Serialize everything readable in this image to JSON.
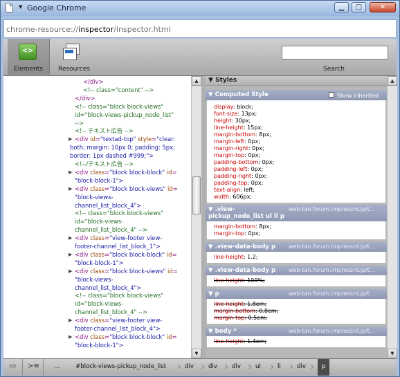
{
  "window": {
    "title": "Google Chrome",
    "controls": [
      "minimize",
      "maximize",
      "close"
    ]
  },
  "address": {
    "prefix": "chrome-resource://",
    "host": "inspector",
    "path": "/inspector.html"
  },
  "toolbar": {
    "elements_label": "Elements",
    "resources_label": "Resources",
    "search_label": "Search",
    "search_value": ""
  },
  "dom_tree": [
    [
      {
        "t": "tag",
        "v": "</div>"
      }
    ],
    [
      {
        "t": "cmt",
        "v": "<!-- class=\"content\" -->"
      }
    ],
    [
      {
        "t": "tag",
        "v": "</div>"
      }
    ],
    [
      {
        "t": "cmt",
        "v": "<!-- class=\"block block-views\""
      }
    ],
    [
      {
        "t": "cmt",
        "v": "id=\"block-views-pickup_node_list\""
      }
    ],
    [
      {
        "t": "cmt",
        "v": "-->"
      }
    ],
    [
      {
        "t": "cmt",
        "v": "<!-- テキスト広告 -->"
      }
    ],
    [
      {
        "t": "tag",
        "v": "<div "
      },
      {
        "t": "attr",
        "v": "id"
      },
      {
        "t": "tag",
        "v": "="
      },
      {
        "t": "val",
        "v": "\"textad-top\""
      },
      {
        "t": "attr",
        "v": " style"
      },
      {
        "t": "tag",
        "v": "="
      },
      {
        "t": "val",
        "v": "\"clear:"
      }
    ],
    [
      {
        "t": "val",
        "v": "both; margin: 10px 0; padding: 5px;"
      }
    ],
    [
      {
        "t": "val",
        "v": "border: 1px dashed #999;\">"
      }
    ],
    [
      {
        "t": "cmt",
        "v": "<!--/テキスト広告 -->"
      }
    ],
    [
      {
        "t": "tag",
        "v": "<div "
      },
      {
        "t": "attr",
        "v": "class"
      },
      {
        "t": "tag",
        "v": "="
      },
      {
        "t": "val",
        "v": "\"block block-block\""
      },
      {
        "t": "attr",
        "v": " id"
      },
      {
        "t": "tag",
        "v": "="
      }
    ],
    [
      {
        "t": "val",
        "v": "\"block-block-1\">"
      }
    ],
    [
      {
        "t": "tag",
        "v": "<div "
      },
      {
        "t": "attr",
        "v": "class"
      },
      {
        "t": "tag",
        "v": "="
      },
      {
        "t": "val",
        "v": "\"block block-views\""
      },
      {
        "t": "attr",
        "v": " id"
      },
      {
        "t": "tag",
        "v": "="
      }
    ],
    [
      {
        "t": "val",
        "v": "\"block-views-"
      }
    ],
    [
      {
        "t": "val",
        "v": "channel_list_block_4\">"
      }
    ],
    [
      {
        "t": "cmt",
        "v": "<!-- class=\"block block-views\""
      }
    ],
    [
      {
        "t": "cmt",
        "v": "id=\"block-views-"
      }
    ],
    [
      {
        "t": "cmt",
        "v": "channel_list_block_4\" -->"
      }
    ],
    [
      {
        "t": "tag",
        "v": "<div "
      },
      {
        "t": "attr",
        "v": "class"
      },
      {
        "t": "tag",
        "v": "="
      },
      {
        "t": "val",
        "v": "\"view-footer view-"
      }
    ],
    [
      {
        "t": "val",
        "v": "footer-channel_list_block_1\">"
      }
    ],
    [
      {
        "t": "tag",
        "v": "<div "
      },
      {
        "t": "attr",
        "v": "class"
      },
      {
        "t": "tag",
        "v": "="
      },
      {
        "t": "val",
        "v": "\"block block-block\""
      },
      {
        "t": "attr",
        "v": " id"
      },
      {
        "t": "tag",
        "v": "="
      }
    ],
    [
      {
        "t": "val",
        "v": "\"block-block-1\">"
      }
    ],
    [
      {
        "t": "tag",
        "v": "<div "
      },
      {
        "t": "attr",
        "v": "class"
      },
      {
        "t": "tag",
        "v": "="
      },
      {
        "t": "val",
        "v": "\"block block-views\""
      },
      {
        "t": "attr",
        "v": " id"
      },
      {
        "t": "tag",
        "v": "="
      }
    ],
    [
      {
        "t": "val",
        "v": "\"block-views-"
      }
    ],
    [
      {
        "t": "val",
        "v": "channel_list_block_4\">"
      }
    ],
    [
      {
        "t": "cmt",
        "v": "<!-- class=\"block block-views\""
      }
    ],
    [
      {
        "t": "cmt",
        "v": "id=\"block-views-"
      }
    ],
    [
      {
        "t": "cmt",
        "v": "channel_list_block_4\" -->"
      }
    ],
    [
      {
        "t": "tag",
        "v": "<div "
      },
      {
        "t": "attr",
        "v": "class"
      },
      {
        "t": "tag",
        "v": "="
      },
      {
        "t": "val",
        "v": "\"view-footer view-"
      }
    ],
    [
      {
        "t": "val",
        "v": "footer-channel_list_block_4\">"
      }
    ],
    [
      {
        "t": "tag",
        "v": "<div "
      },
      {
        "t": "attr",
        "v": "class"
      },
      {
        "t": "tag",
        "v": "="
      },
      {
        "t": "val",
        "v": "\"block block-block\""
      },
      {
        "t": "attr",
        "v": " id"
      },
      {
        "t": "tag",
        "v": "="
      }
    ],
    [
      {
        "t": "val",
        "v": "\"block-block-1\">"
      }
    ]
  ],
  "styles": {
    "header": "Styles",
    "computed_title": "Computed Style",
    "show_inherited": "Show inherited",
    "computed": [
      [
        "display",
        "block;"
      ],
      [
        "font-size",
        "13px;"
      ],
      [
        "height",
        "30px;"
      ],
      [
        "line-height",
        "15px;"
      ],
      [
        "margin-bottom",
        "8px;"
      ],
      [
        "margin-left",
        "0px;"
      ],
      [
        "margin-right",
        "0px;"
      ],
      [
        "margin-top",
        "0px;"
      ],
      [
        "padding-bottom",
        "0px;"
      ],
      [
        "padding-left",
        "0px;"
      ],
      [
        "padding-right",
        "0px;"
      ],
      [
        "padding-top",
        "0px;"
      ],
      [
        "text-align",
        "left;"
      ],
      [
        "width",
        "606px;"
      ]
    ],
    "rules": [
      {
        "selector": [
          ".view-",
          "pickup_node_list ul li p"
        ],
        "source": "web-tan.forum.impressrd.jp/t…",
        "props": [
          [
            "margin-bottom",
            "8px;",
            false
          ],
          [
            "margin-top",
            "0px;",
            false
          ]
        ]
      },
      {
        "selector": [
          ".view-data-body p"
        ],
        "source": "web-tan.forum.impressrd.jp/t…",
        "props": [
          [
            "line-height",
            "1.2;",
            false
          ]
        ]
      },
      {
        "selector": [
          ".view-data-body p"
        ],
        "source": "web-tan.forum.impressrd.jp/t…",
        "props": [
          [
            "line-height",
            "100%;",
            true
          ]
        ]
      },
      {
        "selector": [
          "p"
        ],
        "source": "web-tan.forum.impressrd.jp/t…",
        "props": [
          [
            "line-height",
            "1.8em;",
            true
          ],
          [
            "margin-bottom",
            "0.8em;",
            true
          ],
          [
            "margin-top",
            "0.5em;",
            true
          ]
        ]
      },
      {
        "selector": [
          "body *"
        ],
        "source": "web-tan.forum.impressrd.jp/t…",
        "props": [
          [
            "line-height",
            "1.4em;",
            true
          ]
        ]
      }
    ]
  },
  "breadcrumbs": [
    "…",
    "#block-views-pickup_node_list",
    "div",
    "div",
    "div",
    "ul",
    "li",
    "div",
    "p"
  ],
  "colors": {
    "tag": "#881280",
    "attr": "#994500",
    "value": "#1a1aa6",
    "comment": "#236e25",
    "prop_name": "#c80000"
  }
}
